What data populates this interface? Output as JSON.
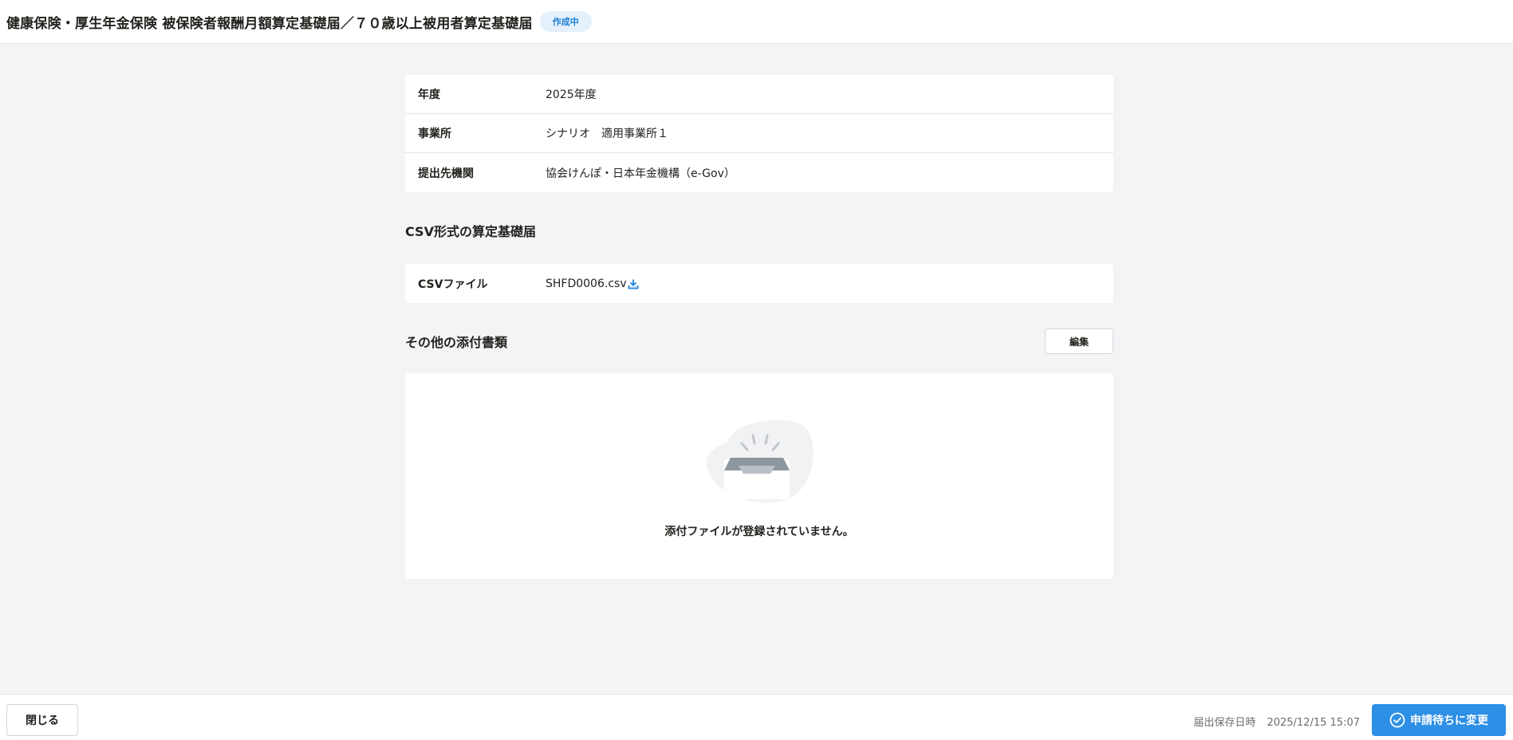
{
  "header": {
    "title": "健康保険・厚生年金保険 被保険者報酬月額算定基礎届／７０歳以上被用者算定基礎届",
    "status_badge": "作成中"
  },
  "info": {
    "rows": [
      {
        "label": "年度",
        "value": "2025年度"
      },
      {
        "label": "事業所",
        "value": "シナリオ　適用事業所１"
      },
      {
        "label": "提出先機関",
        "value": "協会けんぽ・日本年金機構（e-Gov）"
      }
    ]
  },
  "csv_section": {
    "title": "CSV形式の算定基礎届",
    "label": "CSVファイル",
    "file_name": "SHFD0006.csv",
    "icon": "download-icon"
  },
  "attachments": {
    "title": "その他の添付書類",
    "edit_label": "編集",
    "empty_message": "添付ファイルが登録されていません。",
    "illustration": "empty-inbox-icon"
  },
  "footer": {
    "close_label": "閉じる",
    "saved_label": "届出保存日時",
    "saved_value": "2025/12/15 15:07",
    "submit_label": "申請待ちに変更",
    "submit_icon": "check-circle-icon"
  },
  "colors": {
    "accent": "#2d8fe6",
    "badge_bg": "#e4f1fc",
    "badge_text": "#1d7fd3",
    "page_bg": "#f3f4f6"
  }
}
